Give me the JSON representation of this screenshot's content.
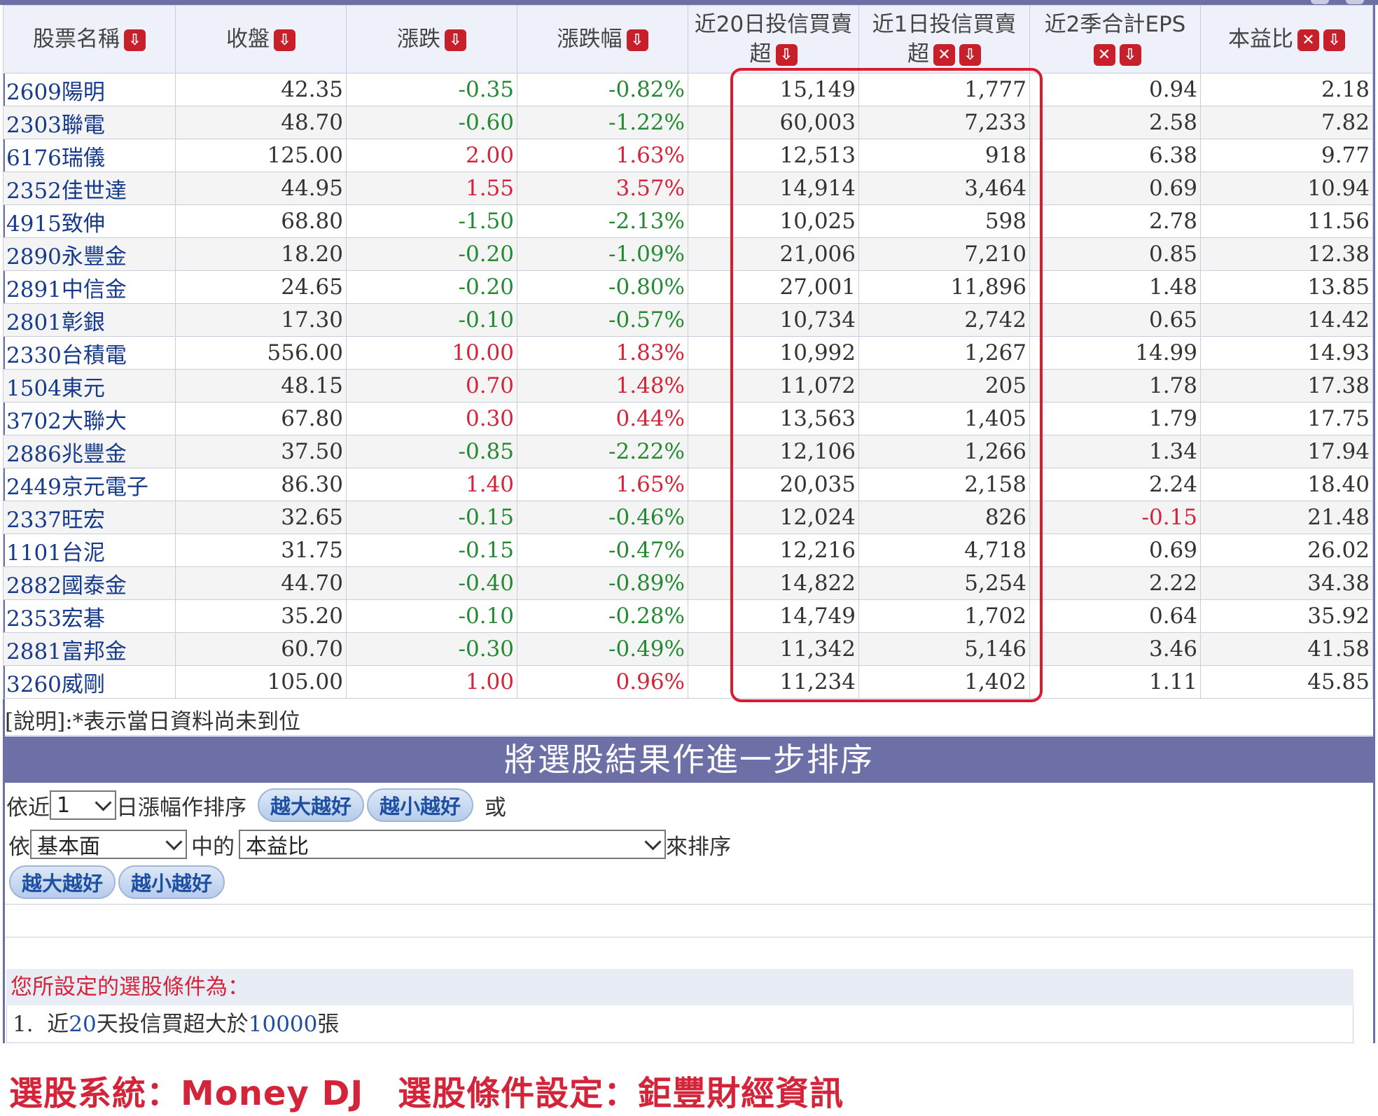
{
  "columns": [
    {
      "label": "股票名稱",
      "line2": "",
      "icons": [
        "sort-desc"
      ]
    },
    {
      "label": "收盤",
      "line2": "",
      "icons": [
        "sort-desc"
      ]
    },
    {
      "label": "漲跌",
      "line2": "",
      "icons": [
        "sort-desc"
      ]
    },
    {
      "label": "漲跌幅",
      "line2": "",
      "icons": [
        "sort-desc"
      ]
    },
    {
      "label": "近20日投信買賣",
      "line2": "超",
      "icons": [
        "sort-desc"
      ]
    },
    {
      "label": "近1日投信買賣",
      "line2": "超",
      "icons": [
        "remove",
        "sort-desc"
      ]
    },
    {
      "label": "近2季合計EPS",
      "line2": "",
      "icons": [
        "remove",
        "sort-desc"
      ]
    },
    {
      "label": "本益比",
      "line2": "",
      "icons": [
        "remove",
        "sort-desc"
      ]
    }
  ],
  "rows": [
    {
      "name": "2609陽明",
      "close": "42.35",
      "chg": "-0.35",
      "pct": "-0.82%",
      "inv20": "15,149",
      "inv1": "1,777",
      "eps": "0.94",
      "pe": "2.18"
    },
    {
      "name": "2303聯電",
      "close": "48.70",
      "chg": "-0.60",
      "pct": "-1.22%",
      "inv20": "60,003",
      "inv1": "7,233",
      "eps": "2.58",
      "pe": "7.82"
    },
    {
      "name": "6176瑞儀",
      "close": "125.00",
      "chg": "2.00",
      "pct": "1.63%",
      "inv20": "12,513",
      "inv1": "918",
      "eps": "6.38",
      "pe": "9.77"
    },
    {
      "name": "2352佳世達",
      "close": "44.95",
      "chg": "1.55",
      "pct": "3.57%",
      "inv20": "14,914",
      "inv1": "3,464",
      "eps": "0.69",
      "pe": "10.94"
    },
    {
      "name": "4915致伸",
      "close": "68.80",
      "chg": "-1.50",
      "pct": "-2.13%",
      "inv20": "10,025",
      "inv1": "598",
      "eps": "2.78",
      "pe": "11.56"
    },
    {
      "name": "2890永豐金",
      "close": "18.20",
      "chg": "-0.20",
      "pct": "-1.09%",
      "inv20": "21,006",
      "inv1": "7,210",
      "eps": "0.85",
      "pe": "12.38"
    },
    {
      "name": "2891中信金",
      "close": "24.65",
      "chg": "-0.20",
      "pct": "-0.80%",
      "inv20": "27,001",
      "inv1": "11,896",
      "eps": "1.48",
      "pe": "13.85"
    },
    {
      "name": "2801彰銀",
      "close": "17.30",
      "chg": "-0.10",
      "pct": "-0.57%",
      "inv20": "10,734",
      "inv1": "2,742",
      "eps": "0.65",
      "pe": "14.42"
    },
    {
      "name": "2330台積電",
      "close": "556.00",
      "chg": "10.00",
      "pct": "1.83%",
      "inv20": "10,992",
      "inv1": "1,267",
      "eps": "14.99",
      "pe": "14.93"
    },
    {
      "name": "1504東元",
      "close": "48.15",
      "chg": "0.70",
      "pct": "1.48%",
      "inv20": "11,072",
      "inv1": "205",
      "eps": "1.78",
      "pe": "17.38"
    },
    {
      "name": "3702大聯大",
      "close": "67.80",
      "chg": "0.30",
      "pct": "0.44%",
      "inv20": "13,563",
      "inv1": "1,405",
      "eps": "1.79",
      "pe": "17.75"
    },
    {
      "name": "2886兆豐金",
      "close": "37.50",
      "chg": "-0.85",
      "pct": "-2.22%",
      "inv20": "12,106",
      "inv1": "1,266",
      "eps": "1.34",
      "pe": "17.94"
    },
    {
      "name": "2449京元電子",
      "close": "86.30",
      "chg": "1.40",
      "pct": "1.65%",
      "inv20": "20,035",
      "inv1": "2,158",
      "eps": "2.24",
      "pe": "18.40"
    },
    {
      "name": "2337旺宏",
      "close": "32.65",
      "chg": "-0.15",
      "pct": "-0.46%",
      "inv20": "12,024",
      "inv1": "826",
      "eps": "-0.15",
      "pe": "21.48"
    },
    {
      "name": "1101台泥",
      "close": "31.75",
      "chg": "-0.15",
      "pct": "-0.47%",
      "inv20": "12,216",
      "inv1": "4,718",
      "eps": "0.69",
      "pe": "26.02"
    },
    {
      "name": "2882國泰金",
      "close": "44.70",
      "chg": "-0.40",
      "pct": "-0.89%",
      "inv20": "14,822",
      "inv1": "5,254",
      "eps": "2.22",
      "pe": "34.38"
    },
    {
      "name": "2353宏碁",
      "close": "35.20",
      "chg": "-0.10",
      "pct": "-0.28%",
      "inv20": "14,749",
      "inv1": "1,702",
      "eps": "0.64",
      "pe": "35.92"
    },
    {
      "name": "2881富邦金",
      "close": "60.70",
      "chg": "-0.30",
      "pct": "-0.49%",
      "inv20": "11,342",
      "inv1": "5,146",
      "eps": "3.46",
      "pe": "41.58"
    },
    {
      "name": "3260威剛",
      "close": "105.00",
      "chg": "1.00",
      "pct": "0.96%",
      "inv20": "11,234",
      "inv1": "1,402",
      "eps": "1.11",
      "pe": "45.85"
    }
  ],
  "note": "[說明]:*表示當日資料尚未到位",
  "sort_section": {
    "title": "將選股結果作進一步排序",
    "row1_prefix": "依近",
    "days_value": "1",
    "row1_suffix": "日漲幅作排序",
    "btn_desc": "越大越好",
    "btn_asc": "越小越好",
    "or_text": "或",
    "row2_prefix": "依",
    "category_value": "基本面",
    "row2_middle": "中的",
    "field_value": "本益比",
    "row2_suffix": "來排序",
    "btn2_desc": "越大越好",
    "btn2_asc": "越小越好"
  },
  "conditions": {
    "heading": "您所設定的選股條件為：",
    "item_prefix": "1.  近",
    "item_days": "20",
    "item_mid": "天投信買超大於",
    "item_amount": "10000",
    "item_suffix": "張"
  },
  "footer": "選股系統：Money DJ　選股條件設定：鉅豐財經資訊",
  "colors": {
    "header_bar": "#6d70a6",
    "up": "#d4243a",
    "down": "#248a32",
    "link": "#163a8c",
    "highlight_box": "#dd1b30"
  }
}
